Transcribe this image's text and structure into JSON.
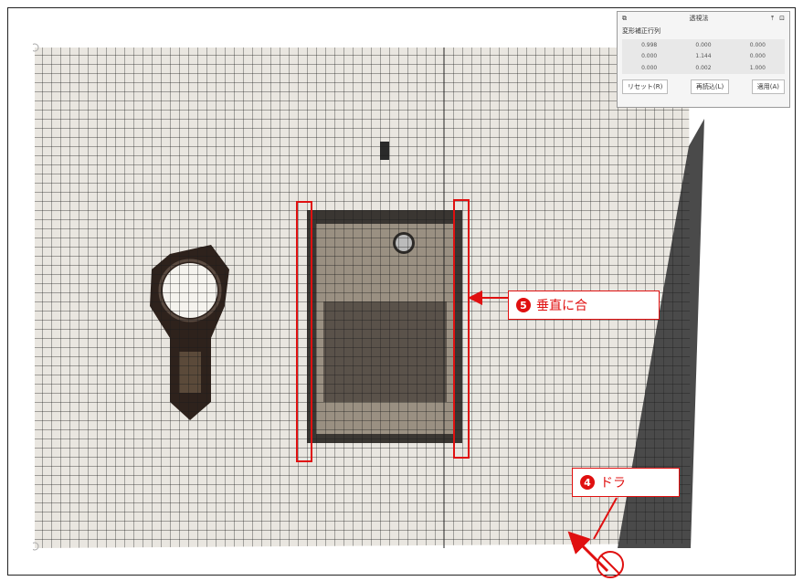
{
  "panel": {
    "title": "透視法",
    "subtitle": "変形補正行列",
    "matrix": [
      "0.998",
      "0.000",
      "0.000",
      "0.000",
      "1.144",
      "0.000",
      "0.000",
      "0.002",
      "1.000"
    ],
    "buttons": [
      "リセット(R)",
      "再読込(L)",
      "適用(A)"
    ]
  },
  "callout5": {
    "number": "5",
    "text": "垂直に合"
  },
  "callout4": {
    "number": "4",
    "text": "ドラ"
  }
}
